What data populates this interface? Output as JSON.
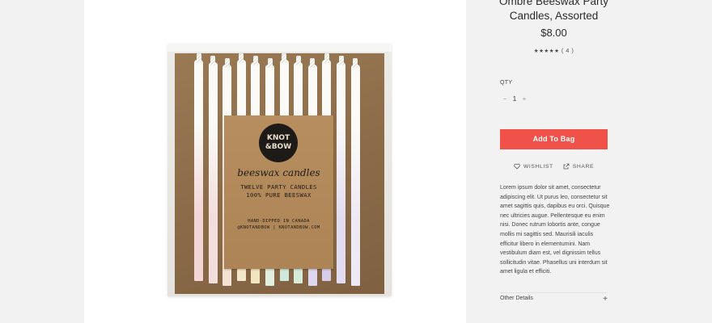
{
  "product": {
    "title": "Ombre Beeswax Party Candles, Assorted",
    "price": "$8.00",
    "stars": "★★★★★",
    "review_count": "( 4 )",
    "rating": 5
  },
  "quantity": {
    "label": "QTY",
    "decrement": "−",
    "value": "1",
    "increment": "+"
  },
  "add_button": "Add To Bag",
  "actions": {
    "wishlist": "WISHLIST",
    "share": "SHARE"
  },
  "description": "Lorem ipsum dolor sit amet, consectetur adipiscing elit. Ut purus leo, consectetur sit amet sagittis quis, dapibus eu orci. Quisque nec ultricies augue. Pellentesque eu enim nisi. Donec rutrum lobortis ante, congue mollis mi sagittis sed. Maurisili iaculis efficitur libero in elementumini. Nam vestibulum diam est, vel dignissim tellus sollicitudin vitae. Phasellus uni interdum sit amet ligula et efficiti.",
  "other_details": {
    "label": "Other Details",
    "toggle": "+"
  },
  "packaging": {
    "brand_line1": "KNOT",
    "brand_line2": "&BOW",
    "script": "beeswax candles",
    "line1": "TWELVE PARTY CANDLES",
    "line2": "100% PURE BEESWAX",
    "line3": "HAND-DIPPED IN CANADA",
    "line4": "@KNOTANDBOW | KNOTANDBOW.COM"
  },
  "candle_colors": [
    "#f2d6d6",
    "#f3dede",
    "#f4e3d4",
    "#f3e7c9",
    "#f2e6c0",
    "#e0efdf",
    "#cfe9dc",
    "#d5ecd9",
    "#ddd7ef",
    "#d6cdea",
    "#e1dcef",
    "#eeeaf5"
  ]
}
